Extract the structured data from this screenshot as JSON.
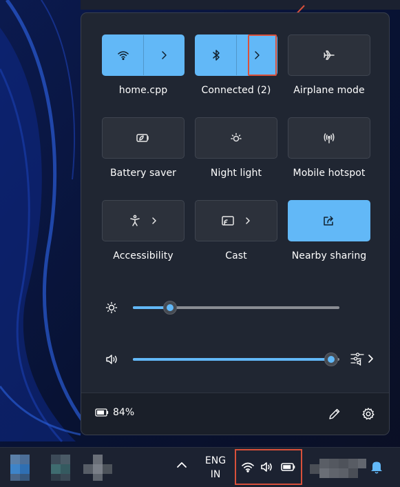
{
  "quick_settings": {
    "tiles": [
      {
        "label": "home.cpp",
        "icon": "wifi-icon",
        "active": true
      },
      {
        "label": "Connected (2)",
        "icon": "bluetooth-icon",
        "active": true
      },
      {
        "label": "Airplane mode",
        "icon": "airplane-icon",
        "active": false
      },
      {
        "label": "Battery saver",
        "icon": "battery-saver-icon",
        "active": false
      },
      {
        "label": "Night light",
        "icon": "night-light-icon",
        "active": false
      },
      {
        "label": "Mobile hotspot",
        "icon": "hotspot-icon",
        "active": false
      },
      {
        "label": "Accessibility",
        "icon": "accessibility-icon",
        "active": false
      },
      {
        "label": "Cast",
        "icon": "cast-icon",
        "active": false
      },
      {
        "label": "Nearby sharing",
        "icon": "share-icon",
        "active": true
      }
    ],
    "brightness": {
      "icon": "brightness-icon",
      "level_percent": 18
    },
    "volume": {
      "icon": "speaker-icon",
      "level_percent": 96
    },
    "footer": {
      "battery_text": "84%",
      "battery_level_percent": 84
    }
  },
  "taskbar": {
    "lang_line1": "ENG",
    "lang_line2": "IN"
  },
  "colors": {
    "accent": "#62b8f7",
    "panel_bg": "#202632",
    "highlight": "#d9503a"
  }
}
